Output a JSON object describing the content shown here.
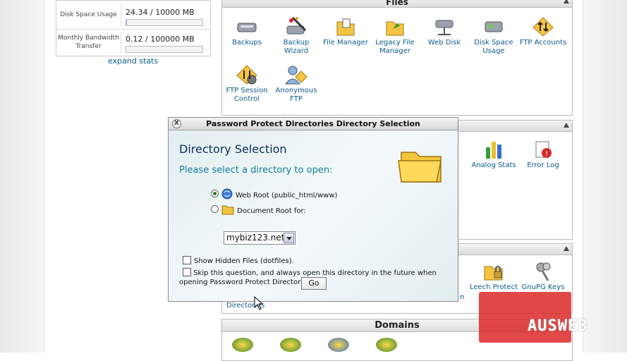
{
  "stats": {
    "disk_label": "Disk Space Usage",
    "disk_value": "24.34 / 10000 MB",
    "disk_fraction": 0.0024,
    "bandwidth_label": "Monthly Bandwidth Transfer",
    "bandwidth_value": "0.12 / 100000 MB",
    "bandwidth_fraction": 1.2e-06,
    "expand_label": "expand stats"
  },
  "files_panel": {
    "title": "Files",
    "items": [
      {
        "label": "Backups",
        "icon": "backups-icon"
      },
      {
        "label": "Backup Wizard",
        "icon": "backup-wizard-icon"
      },
      {
        "label": "File Manager",
        "icon": "file-manager-icon"
      },
      {
        "label": "Legacy File Manager",
        "icon": "legacy-file-manager-icon"
      },
      {
        "label": "Web Disk",
        "icon": "web-disk-icon"
      },
      {
        "label": "Disk Space Usage",
        "icon": "disk-space-usage-icon"
      },
      {
        "label": "FTP Accounts",
        "icon": "ftp-accounts-icon"
      },
      {
        "label": "FTP Session Control",
        "icon": "ftp-session-control-icon"
      },
      {
        "label": "Anonymous FTP",
        "icon": "anonymous-ftp-icon"
      }
    ]
  },
  "logs_panel": {
    "items": [
      {
        "label": "Analog Stats",
        "icon": "analog-stats-icon"
      },
      {
        "label": "Error Log",
        "icon": "error-log-icon"
      }
    ]
  },
  "security_panel": {
    "items": [
      {
        "label": "Leech Protect",
        "icon": "leech-protect-icon"
      },
      {
        "label": "GnuPG Keys",
        "icon": "gnupg-keys-icon"
      }
    ],
    "partial_label": "Directories",
    "partial_right": "n"
  },
  "domains_panel": {
    "title": "Domains"
  },
  "dialog": {
    "title": "Password Protect Directories Directory Selection",
    "close_label": "X",
    "heading": "Directory Selection",
    "subheading": "Please select a directory to open:",
    "option_webroot": "Web Root (public_html/www)",
    "option_docroot": "Document Root for:",
    "domain_selected": "mybiz123.net",
    "show_hidden": "Show Hidden Files (dotfiles).",
    "skip_question": "Skip this question, and always open this directory in the future when opening Password Protect Directories.",
    "go_label": "Go"
  },
  "brand": {
    "logo_text": "AUSWEB",
    "accent": "#dc2828"
  }
}
